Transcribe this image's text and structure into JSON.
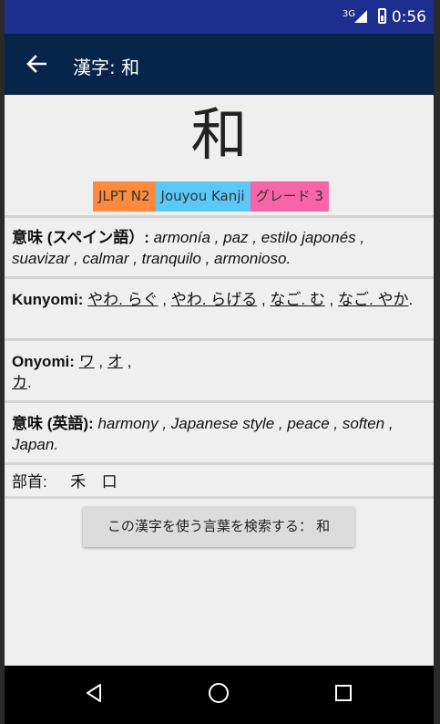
{
  "status_bar": {
    "network": "3G",
    "time": "0:56"
  },
  "app_bar": {
    "title": "漢字:  和"
  },
  "kanji": {
    "character": "和",
    "tags": [
      {
        "label": "JLPT N2",
        "color": "#ff8a3d"
      },
      {
        "label": "Jouyou Kanji",
        "color": "#5cc8f8"
      },
      {
        "label": "グレード 3",
        "color": "#f864a8"
      }
    ]
  },
  "meaning_es": {
    "label": "意味 (スペイン語）:",
    "text": "armonía , paz , estilo japonés , suavizar , calmar , tranquilo , armonioso."
  },
  "kunyomi": {
    "label": "Kunyomi:",
    "readings": [
      "やわ. らぐ",
      "やわ. らげる",
      "なご. む",
      "なご. やか"
    ],
    "separator": " , ",
    "end": "."
  },
  "onyomi": {
    "label": "Onyomi:",
    "readings": [
      "ワ",
      "オ",
      "カ"
    ],
    "separator": " , ",
    "end": "."
  },
  "meaning_en": {
    "label": "意味 (英語):",
    "text": "harmony , Japanese style , peace , soften , Japan."
  },
  "radicals": {
    "label": "部首:",
    "items": [
      "禾",
      "口"
    ]
  },
  "search_button": {
    "label": "この漢字を使う言葉を検索する： 和"
  }
}
